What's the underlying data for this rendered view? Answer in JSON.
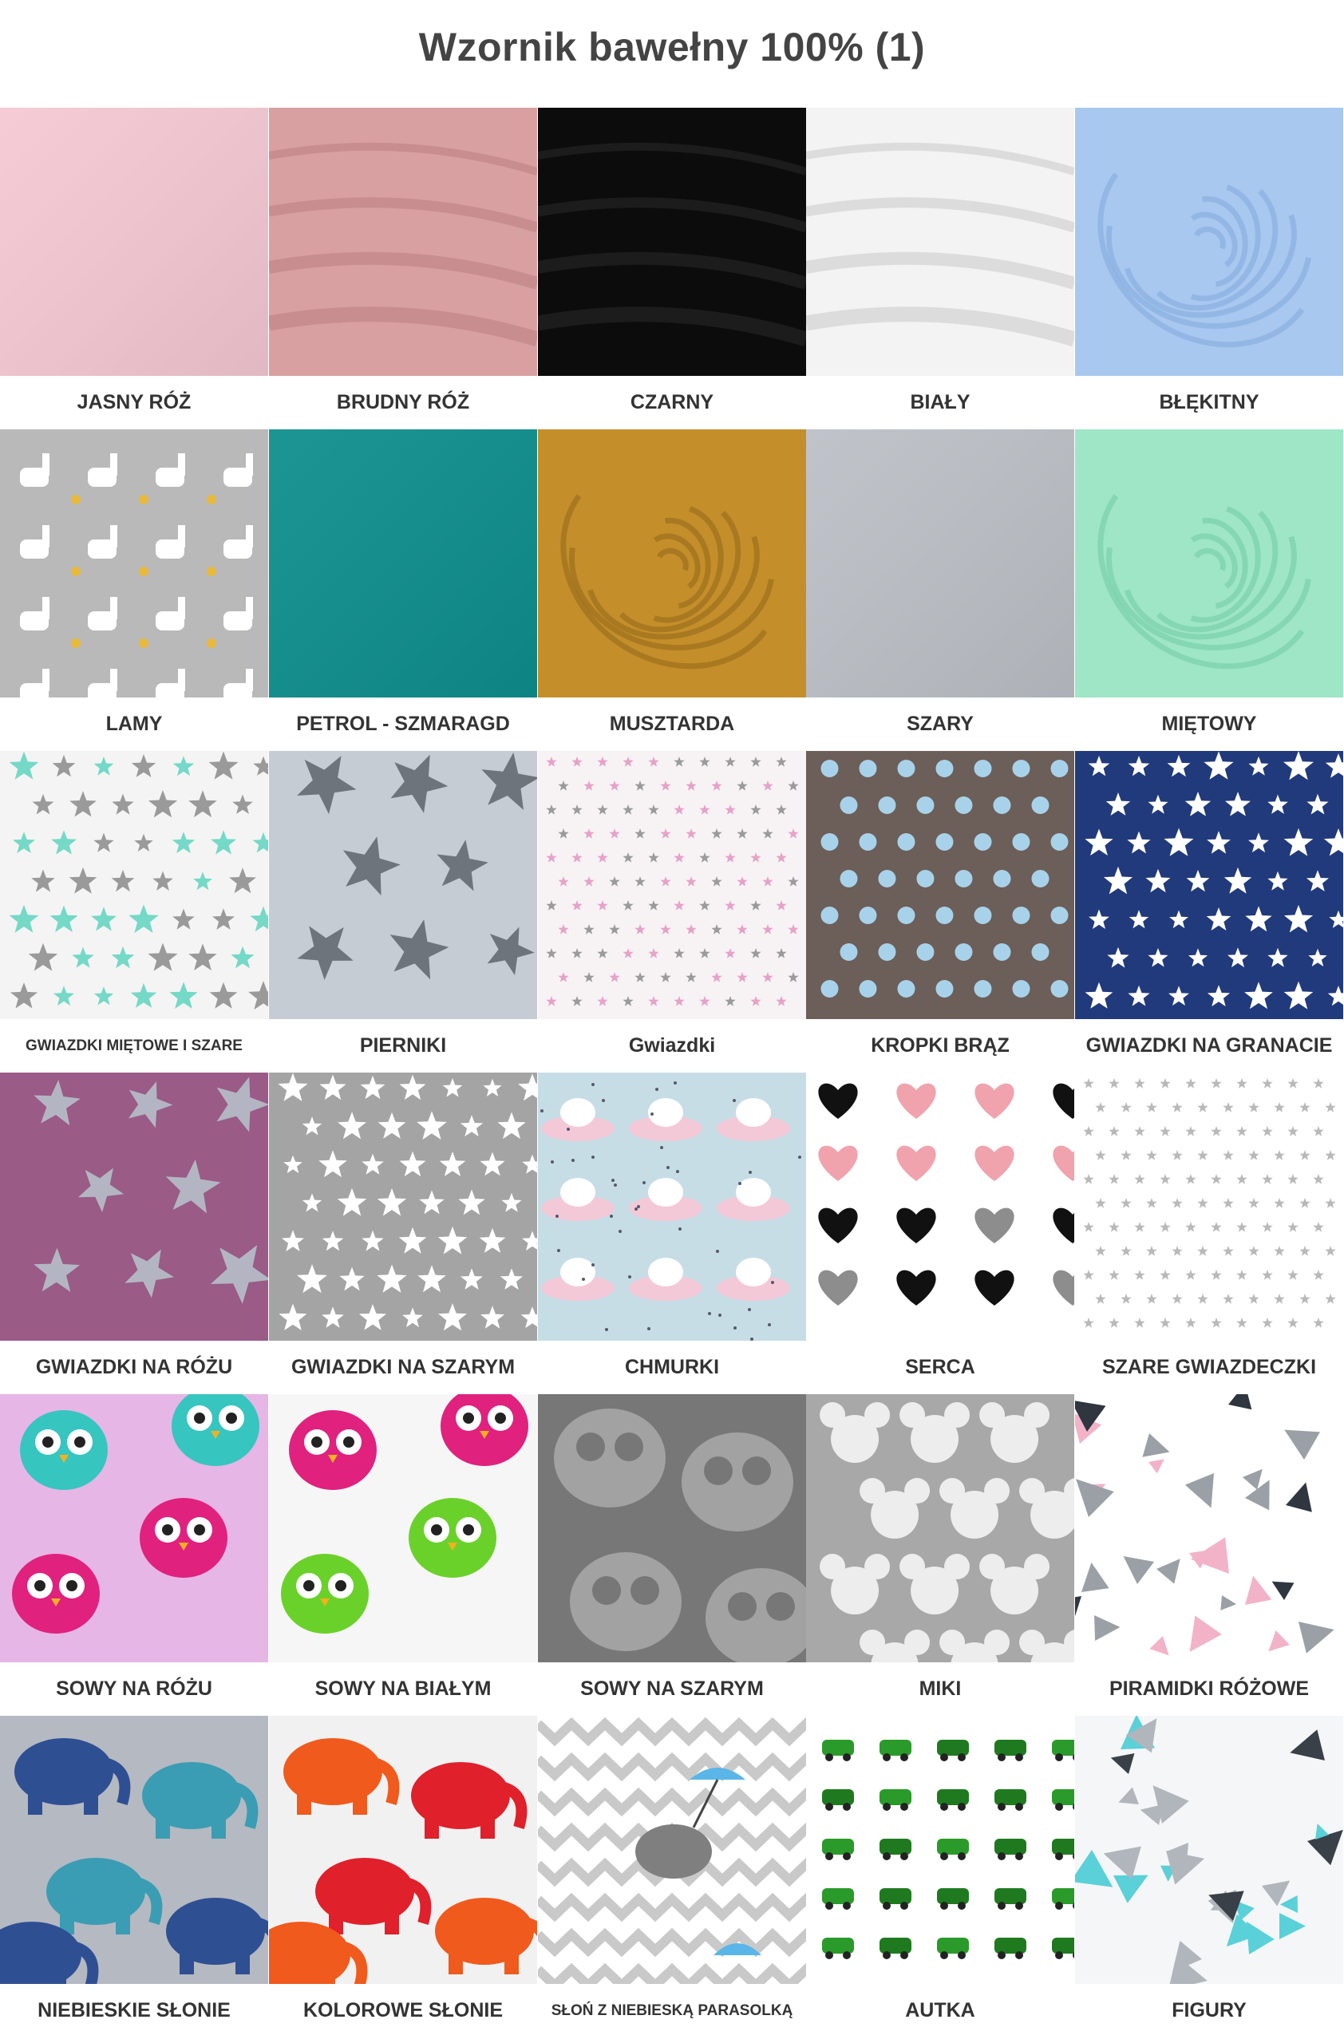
{
  "title": "Wzornik bawełny 100% (1)",
  "swatches": [
    [
      {
        "label": "JASNY RÓŻ",
        "pattern": "solid",
        "colors": [
          "#f5c8d3"
        ]
      },
      {
        "label": "BRUDNY RÓŻ",
        "pattern": "folds",
        "colors": [
          "#d9a0a2",
          "#b87d80"
        ]
      },
      {
        "label": "CZARNY",
        "pattern": "folds",
        "colors": [
          "#0c0c0c",
          "#2a2a2a"
        ]
      },
      {
        "label": "BIAŁY",
        "pattern": "folds",
        "colors": [
          "#f3f3f3",
          "#c9c9c9"
        ]
      },
      {
        "label": "BŁĘKITNY",
        "pattern": "swirl",
        "colors": [
          "#a9c8ef",
          "#7ea6dc"
        ]
      }
    ],
    [
      {
        "label": "LAMY",
        "pattern": "llamas",
        "colors": [
          "#b9b9b9",
          "#ffffff",
          "#e8b93a"
        ]
      },
      {
        "label": "PETROL - SZMARAGD",
        "pattern": "solid",
        "colors": [
          "#0e8e8e"
        ]
      },
      {
        "label": "MUSZTARDA",
        "pattern": "swirl",
        "colors": [
          "#c48f2a",
          "#8e6418"
        ]
      },
      {
        "label": "SZARY",
        "pattern": "solid",
        "colors": [
          "#bcc0c6"
        ]
      },
      {
        "label": "MIĘTOWY",
        "pattern": "swirl",
        "colors": [
          "#9ee6c6",
          "#6cc8a2"
        ]
      }
    ],
    [
      {
        "label": "GWIAZDKI MIĘTOWE I SZARE",
        "pattern": "stars",
        "colors": [
          "#f4f4f4",
          "#74d9c6",
          "#9a9a9a"
        ],
        "labelSize": "small"
      },
      {
        "label": "PIERNIKI",
        "pattern": "bigstars",
        "colors": [
          "#c6ccd4",
          "#6e747b"
        ]
      },
      {
        "label": "Gwiazdki",
        "pattern": "tinystars",
        "colors": [
          "#f7f3f5",
          "#e7a2c8",
          "#9b9b9b"
        ]
      },
      {
        "label": "KROPKI BRĄZ",
        "pattern": "dots",
        "colors": [
          "#6c5e58",
          "#a8d2ea"
        ]
      },
      {
        "label": "GWIAZDKI NA GRANACIE",
        "pattern": "stars",
        "colors": [
          "#213a7c",
          "#ffffff",
          "#ffffff"
        ]
      }
    ],
    [
      {
        "label": "GWIAZDKI NA RÓŻU",
        "pattern": "bigstars",
        "colors": [
          "#9a5b86",
          "#b3b6c2"
        ]
      },
      {
        "label": "GWIAZDKI NA SZARYM",
        "pattern": "stars",
        "colors": [
          "#a4a4a4",
          "#ffffff",
          "#ffffff"
        ]
      },
      {
        "label": "CHMURKI",
        "pattern": "unicorns",
        "colors": [
          "#c7dde6",
          "#f3c9d8",
          "#ffffff"
        ]
      },
      {
        "label": "SERCA",
        "pattern": "hearts",
        "colors": [
          "#ffffff",
          "#111111",
          "#f0a3ad",
          "#8d8d8d"
        ]
      },
      {
        "label": "SZARE GWIAZDECZKI",
        "pattern": "tinystars",
        "colors": [
          "#ffffff",
          "#b9b9b9",
          "#b9b9b9"
        ]
      }
    ],
    [
      {
        "label": "SOWY NA RÓŻU",
        "pattern": "owls",
        "colors": [
          "#e6b6e6",
          "#e0217e",
          "#37c5c0"
        ]
      },
      {
        "label": "SOWY NA BIAŁYM",
        "pattern": "owls",
        "colors": [
          "#f6f6f6",
          "#6ad12a",
          "#e0217e"
        ]
      },
      {
        "label": "SOWY NA SZARYM",
        "pattern": "grayowls",
        "colors": [
          "#777777",
          "#a2a2a2"
        ]
      },
      {
        "label": "MIKI",
        "pattern": "mice",
        "colors": [
          "#a8a8a8",
          "#ededed"
        ]
      },
      {
        "label": "PIRAMIDKI RÓŻOWE",
        "pattern": "triangles",
        "colors": [
          "#ffffff",
          "#2f3640",
          "#f2b3c8",
          "#9aa0a6"
        ]
      }
    ],
    [
      {
        "label": "NIEBIESKIE SŁONIE",
        "pattern": "elephants",
        "colors": [
          "#b5b9c2",
          "#2f4f93",
          "#3a9db3"
        ]
      },
      {
        "label": "KOLOROWE SŁONIE",
        "pattern": "elephants",
        "colors": [
          "#f1f1f1",
          "#f05a1c",
          "#e0202a"
        ]
      },
      {
        "label": "SŁOŃ Z NIEBIESKĄ PARASOLKĄ",
        "pattern": "zigzag",
        "colors": [
          "#ffffff",
          "#c9c9c9",
          "#7f7f7f",
          "#5ab5e8"
        ],
        "labelSize": "small"
      },
      {
        "label": "AUTKA",
        "pattern": "cars",
        "colors": [
          "#ffffff",
          "#2a9a2a",
          "#1f7a1f"
        ]
      },
      {
        "label": "FIGURY",
        "pattern": "triangles",
        "colors": [
          "#f4f6f8",
          "#3a4048",
          "#5ad0d8",
          "#b0b6bc"
        ]
      }
    ]
  ]
}
